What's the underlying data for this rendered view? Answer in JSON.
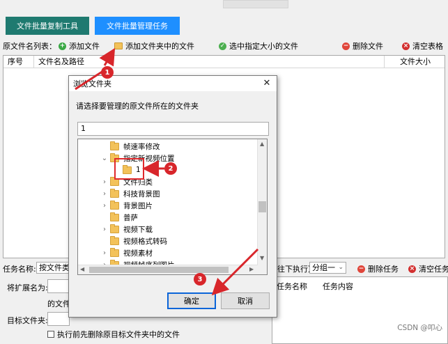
{
  "tabs": {
    "copy_tool": "文件批量复制工具",
    "manage_task": "文件批量管理任务"
  },
  "toolbar": {
    "label": "原文件名列表：",
    "add_file": "添加文件",
    "add_folder_files": "添加文件夹中的文件",
    "select_by_size": "选中指定大小的文件",
    "delete_file": "删除文件",
    "clear_table": "清空表格"
  },
  "table": {
    "col_index": "序号",
    "col_name": "文件名及路径",
    "col_size": "文件大小"
  },
  "task_bar": {
    "task_name_label": "任务名称:",
    "task_name_value": "按文件类型",
    "exec_note": "往下执行）",
    "group_value": "分组一",
    "delete_task": "删除任务",
    "clear_tasks": "清空任务"
  },
  "form": {
    "ext_label": "将扩展名为:",
    "file_label_partial": "的文件",
    "target_label": "目标文件夹:",
    "clear_before_label": "执行前先删除原目标文件夹中的文件"
  },
  "task_table": {
    "col_task_name": "任务名称",
    "col_task_content": "任务内容"
  },
  "dialog": {
    "title": "浏览文件夹",
    "prompt": "请选择要管理的原文件所在的文件夹",
    "path_value": "1",
    "tree": [
      {
        "label": "帧速率修改",
        "level": 1,
        "expander": ""
      },
      {
        "label": "指定新视频位置",
        "level": 1,
        "expander": "expanded"
      },
      {
        "label": "1",
        "level": 2,
        "expander": ""
      },
      {
        "label": "文件归类",
        "level": 1,
        "expander": "collapsed"
      },
      {
        "label": "科技背景图",
        "level": 1,
        "expander": "collapsed"
      },
      {
        "label": "背景图片",
        "level": 1,
        "expander": "collapsed"
      },
      {
        "label": "普萨",
        "level": 1,
        "expander": ""
      },
      {
        "label": "视频下载",
        "level": 1,
        "expander": "collapsed"
      },
      {
        "label": "视频格式转码",
        "level": 1,
        "expander": ""
      },
      {
        "label": "视频素材",
        "level": 1,
        "expander": "collapsed"
      },
      {
        "label": "视频帧序列图片",
        "level": 1,
        "expander": "collapsed"
      }
    ],
    "ok": "确定",
    "cancel": "取消"
  },
  "annotations": {
    "step1": "1",
    "step2": "2",
    "step3": "3"
  },
  "watermark": "CSDN @叩心",
  "colors": {
    "tab_teal": "#1f7a70",
    "tab_blue": "#1e8fff",
    "annotation_red": "#d8262b"
  }
}
